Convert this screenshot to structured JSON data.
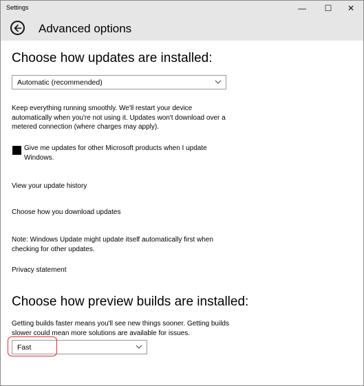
{
  "window": {
    "title": "Settings",
    "controls": {
      "minimize": "—",
      "maximize": "☐",
      "close": "✕"
    }
  },
  "header": {
    "title": "Advanced options"
  },
  "updates_section": {
    "heading": "Choose how updates are installed:",
    "install_mode": {
      "selected": "Automatic (recommended)"
    },
    "description": "Keep everything running smoothly. We'll restart your device automatically when you're not using it. Updates won't download over a metered connection (where charges may apply).",
    "ms_products_checkbox": {
      "label": "Give me updates for other Microsoft products when I update Windows.",
      "checked": false
    },
    "link_history": "View your update history",
    "link_download": "Choose how you download updates",
    "note": "Note: Windows Update might update itself automatically first when checking for other updates.",
    "link_privacy": "Privacy statement"
  },
  "preview_section": {
    "heading": "Choose how preview builds are installed:",
    "description": "Getting builds faster means you'll see new things sooner. Getting builds slower could mean more solutions are available for issues.",
    "ring": {
      "selected": "Fast"
    }
  },
  "colors": {
    "titlebar": "#e6e6e6",
    "annotation": "#e03030"
  }
}
